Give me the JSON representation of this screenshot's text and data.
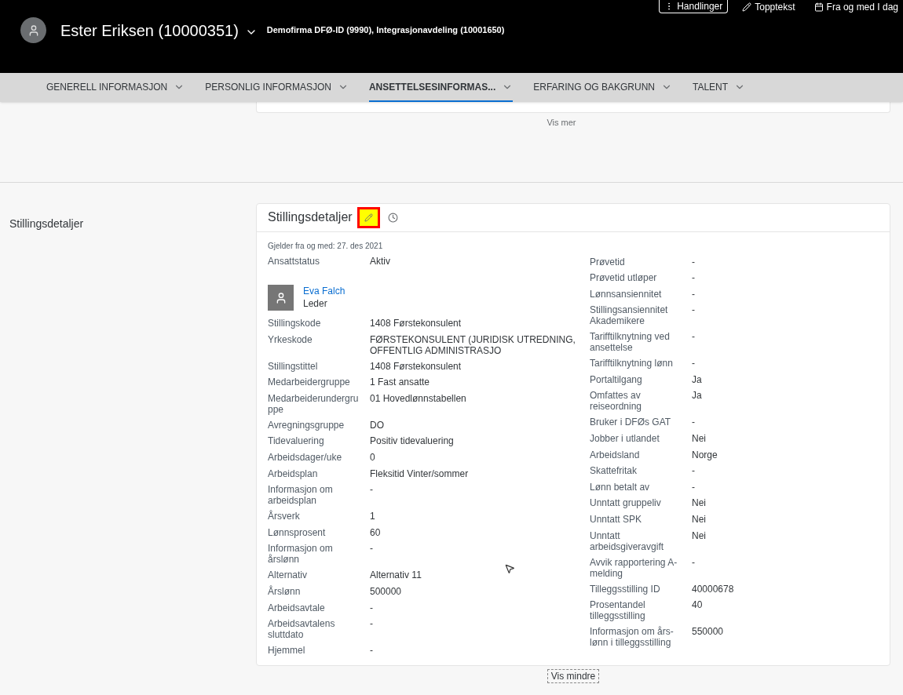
{
  "header": {
    "name": "Ester Eriksen (10000351)",
    "org": "Demofirma DFØ-ID (9990), Integrasjonavdeling (10001650)",
    "actions": [
      {
        "kind": "dots",
        "label": "Handlinger",
        "outlined": true
      },
      {
        "kind": "pencil",
        "label": "Topptekst",
        "outlined": false
      },
      {
        "kind": "calendar",
        "label": "Fra og med I dag",
        "outlined": false
      }
    ]
  },
  "tabs": [
    {
      "label": "GENERELL INFORMASJON",
      "selected": false
    },
    {
      "label": "PERSONLIG INFORMASJON",
      "selected": false
    },
    {
      "label": "ANSETTELSESINFORMAS...",
      "selected": true
    },
    {
      "label": "ERFARING OG BAKGRUNN",
      "selected": false
    },
    {
      "label": "TALENT",
      "selected": false
    }
  ],
  "previous_card": {
    "more_link": "Vis mer"
  },
  "section": {
    "label": "Stillingsdetaljer",
    "card": {
      "title": "Stillingsdetaljer",
      "edit_highlighted": true,
      "effective": "Gjelder fra og med: 27. des 2021",
      "left": [
        {
          "kind": "field",
          "label": "Ansattstatus",
          "value": "Aktiv"
        },
        {
          "kind": "person",
          "name": "Eva Falch",
          "role": "Leder"
        },
        {
          "kind": "field",
          "label": "Stillingskode",
          "value": "1408 Førstekonsulent"
        },
        {
          "kind": "field",
          "label": "Yrkeskode",
          "value": "FØRSTEKONSULENT (JURIDISK UTREDNING, OFFENTLIG ADMINISTRASJO"
        },
        {
          "kind": "field",
          "label": "Stillingstittel",
          "value": "1408 Førstekonsulent"
        },
        {
          "kind": "field",
          "label": "Medarbeidergruppe",
          "value": "1 Fast ansatte"
        },
        {
          "kind": "field",
          "label": "Medarbeiderundergruppe",
          "value": "01 Hovedlønnstabellen"
        },
        {
          "kind": "field",
          "label": "Avregningsgruppe",
          "value": "DO"
        },
        {
          "kind": "field",
          "label": "Tidevaluering",
          "value": "Positiv tidevaluering"
        },
        {
          "kind": "field",
          "label": "Arbeidsdager/uke",
          "value": "0"
        },
        {
          "kind": "field",
          "label": "Arbeidsplan",
          "value": "Fleksitid Vinter/sommer"
        },
        {
          "kind": "field",
          "label": "Informasjon om arbeidsplan",
          "value": "-"
        },
        {
          "kind": "field",
          "label": "Årsverk",
          "value": "1"
        },
        {
          "kind": "field",
          "label": "Lønnsprosent",
          "value": "60"
        },
        {
          "kind": "field",
          "label": "Informasjon om årslønn",
          "value": "-"
        },
        {
          "kind": "field",
          "label": "Alternativ",
          "value": "Alternativ 11"
        },
        {
          "kind": "field",
          "label": "Årslønn",
          "value": "500000"
        },
        {
          "kind": "field",
          "label": "Arbeidsavtale",
          "value": "-"
        },
        {
          "kind": "field",
          "label": "Arbeidsavtalens sluttdato",
          "value": "-"
        },
        {
          "kind": "field",
          "label": "Hjemmel",
          "value": "-"
        }
      ],
      "right": [
        {
          "kind": "field",
          "label": "Prøvetid",
          "value": "-"
        },
        {
          "kind": "field",
          "label": "Prøvetid utløper",
          "value": "-"
        },
        {
          "kind": "field",
          "label": "Lønnsansiennitet",
          "value": "-"
        },
        {
          "kind": "field",
          "label": "Stillingsansiennitet Akademikere",
          "value": "-"
        },
        {
          "kind": "field",
          "label": "Tarifftilknytning ved ansettelse",
          "value": "-"
        },
        {
          "kind": "field",
          "label": "Tarifftilknytning lønn",
          "value": "-"
        },
        {
          "kind": "field",
          "label": "Portaltilgang",
          "value": "Ja"
        },
        {
          "kind": "field",
          "label": "Omfattes av reiseordning",
          "value": "Ja"
        },
        {
          "kind": "field",
          "label": "Bruker i DFØs GAT",
          "value": "-"
        },
        {
          "kind": "field",
          "label": "Jobber i utlandet",
          "value": "Nei"
        },
        {
          "kind": "field",
          "label": "Arbeidsland",
          "value": "Norge"
        },
        {
          "kind": "field",
          "label": "Skattefritak",
          "value": "-"
        },
        {
          "kind": "field",
          "label": "Lønn betalt av",
          "value": "-"
        },
        {
          "kind": "field",
          "label": "Unntatt gruppeliv",
          "value": "Nei"
        },
        {
          "kind": "field",
          "label": "Unntatt SPK",
          "value": "Nei"
        },
        {
          "kind": "field",
          "label": "Unntatt arbeidsgiveravgift",
          "value": "Nei"
        },
        {
          "kind": "field",
          "label": "Avvik rapportering A-melding",
          "value": "-"
        },
        {
          "kind": "field",
          "label": "Tilleggsstilling ID",
          "value": "40000678"
        },
        {
          "kind": "field",
          "label": "Prosentandel tilleggsstilling",
          "value": "40"
        },
        {
          "kind": "field",
          "label": "Informasjon om års-lønn i tilleggsstilling",
          "value": "550000"
        }
      ]
    },
    "less_button": "Vis mindre"
  }
}
